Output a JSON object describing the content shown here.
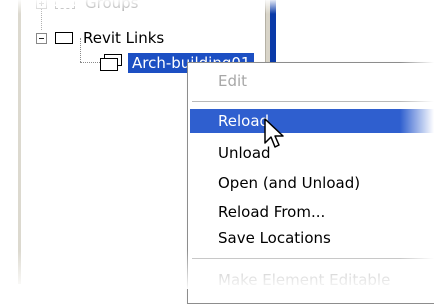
{
  "tree": {
    "groups_label": "Groups",
    "revit_links_label": "Revit Links",
    "link_item_label": "Arch-building01"
  },
  "context_menu": {
    "items": [
      {
        "label": "Edit",
        "enabled": false
      },
      {
        "label": "Reload",
        "enabled": true,
        "highlighted": true
      },
      {
        "label": "Unload",
        "enabled": true
      },
      {
        "label": "Open (and Unload)",
        "enabled": true
      },
      {
        "label": "Reload From...",
        "enabled": true
      },
      {
        "label": "Save Locations",
        "enabled": true
      },
      {
        "label": "Make Element Editable",
        "enabled": false
      }
    ]
  },
  "colors": {
    "selection_blue": "#1c4fc3",
    "menu_highlight": "#2f5fcf",
    "panel_border_blue": "#0a3aa8",
    "disabled_text": "#a7a7a7"
  },
  "icons": {
    "tree_expander": "minus-box-icon",
    "link_folder": "folder-icon",
    "link_item": "linked-model-icon",
    "cursor": "arrow-cursor-icon"
  }
}
